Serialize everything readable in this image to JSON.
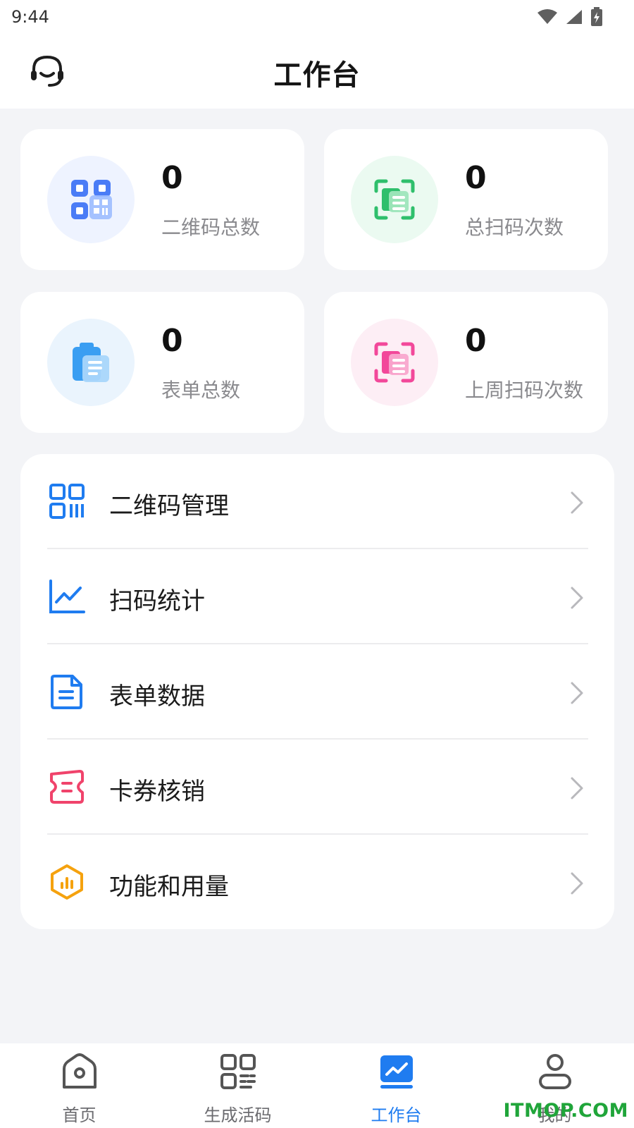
{
  "status_bar": {
    "time": "9:44",
    "icons": [
      "wifi-icon",
      "signal-icon",
      "battery-charging-icon"
    ]
  },
  "header": {
    "title": "工作台",
    "left_icon": "headset-support-icon"
  },
  "stats": [
    {
      "value": "0",
      "label": "二维码总数",
      "icon": "qrcode-grid-icon",
      "color": "#4a7cf6",
      "bg": "#eef3ff"
    },
    {
      "value": "0",
      "label": "总扫码次数",
      "icon": "scan-frame-icon",
      "color": "#2fbf6c",
      "bg": "#ebfaf1"
    },
    {
      "value": "0",
      "label": "表单总数",
      "icon": "clipboard-form-icon",
      "color": "#3a9ef2",
      "bg": "#eaf4fd"
    },
    {
      "value": "0",
      "label": "上周扫码次数",
      "icon": "scan-frame-icon",
      "color": "#f2489a",
      "bg": "#fdeef5"
    }
  ],
  "menu": [
    {
      "label": "二维码管理",
      "icon": "qrcode-icon",
      "color": "#1f7cf0"
    },
    {
      "label": "扫码统计",
      "icon": "line-chart-icon",
      "color": "#1f7cf0"
    },
    {
      "label": "表单数据",
      "icon": "document-icon",
      "color": "#1f7cf0"
    },
    {
      "label": "卡券核销",
      "icon": "ticket-icon",
      "color": "#f0436b"
    },
    {
      "label": "功能和用量",
      "icon": "hexagon-bars-icon",
      "color": "#f5a20e"
    }
  ],
  "tabbar": [
    {
      "label": "首页",
      "icon": "home-icon",
      "active": false
    },
    {
      "label": "生成活码",
      "icon": "qrcode-generate-icon",
      "active": false
    },
    {
      "label": "工作台",
      "icon": "dashboard-chart-icon",
      "active": true
    },
    {
      "label": "我的",
      "icon": "user-icon",
      "active": false
    }
  ],
  "watermark": "ITMOP.COM",
  "colors": {
    "accent": "#1f7cf0",
    "background": "#f3f4f7"
  }
}
